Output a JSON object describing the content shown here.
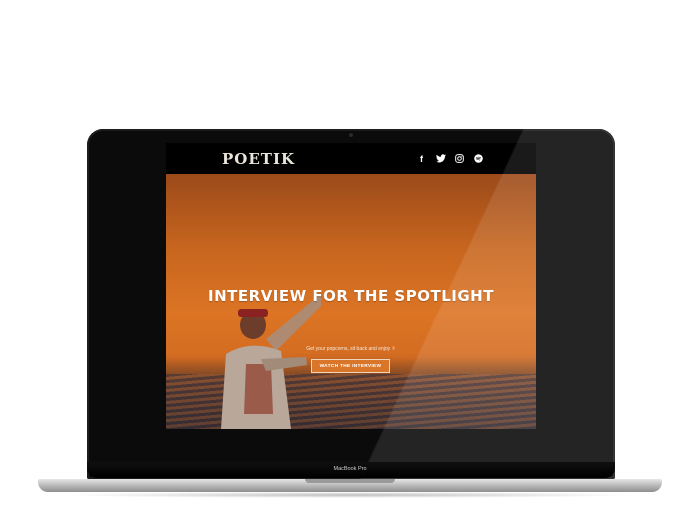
{
  "site": {
    "logo": "POETIK",
    "social": [
      {
        "name": "facebook-icon",
        "glyph": "f"
      },
      {
        "name": "twitter-icon",
        "glyph": "t"
      },
      {
        "name": "instagram-icon",
        "glyph": "◎"
      },
      {
        "name": "spotify-icon",
        "glyph": "●"
      }
    ]
  },
  "hero": {
    "title": "INTERVIEW FOR THE SPOTLIGHT",
    "subtitle": "Get your popcorns, sit back and enjoy ✌",
    "cta_label": "WATCH THE INTERVIEW"
  },
  "device": {
    "model": "MacBook Pro"
  },
  "colors": {
    "accent": "#d9762a",
    "header_bg": "#000000"
  }
}
